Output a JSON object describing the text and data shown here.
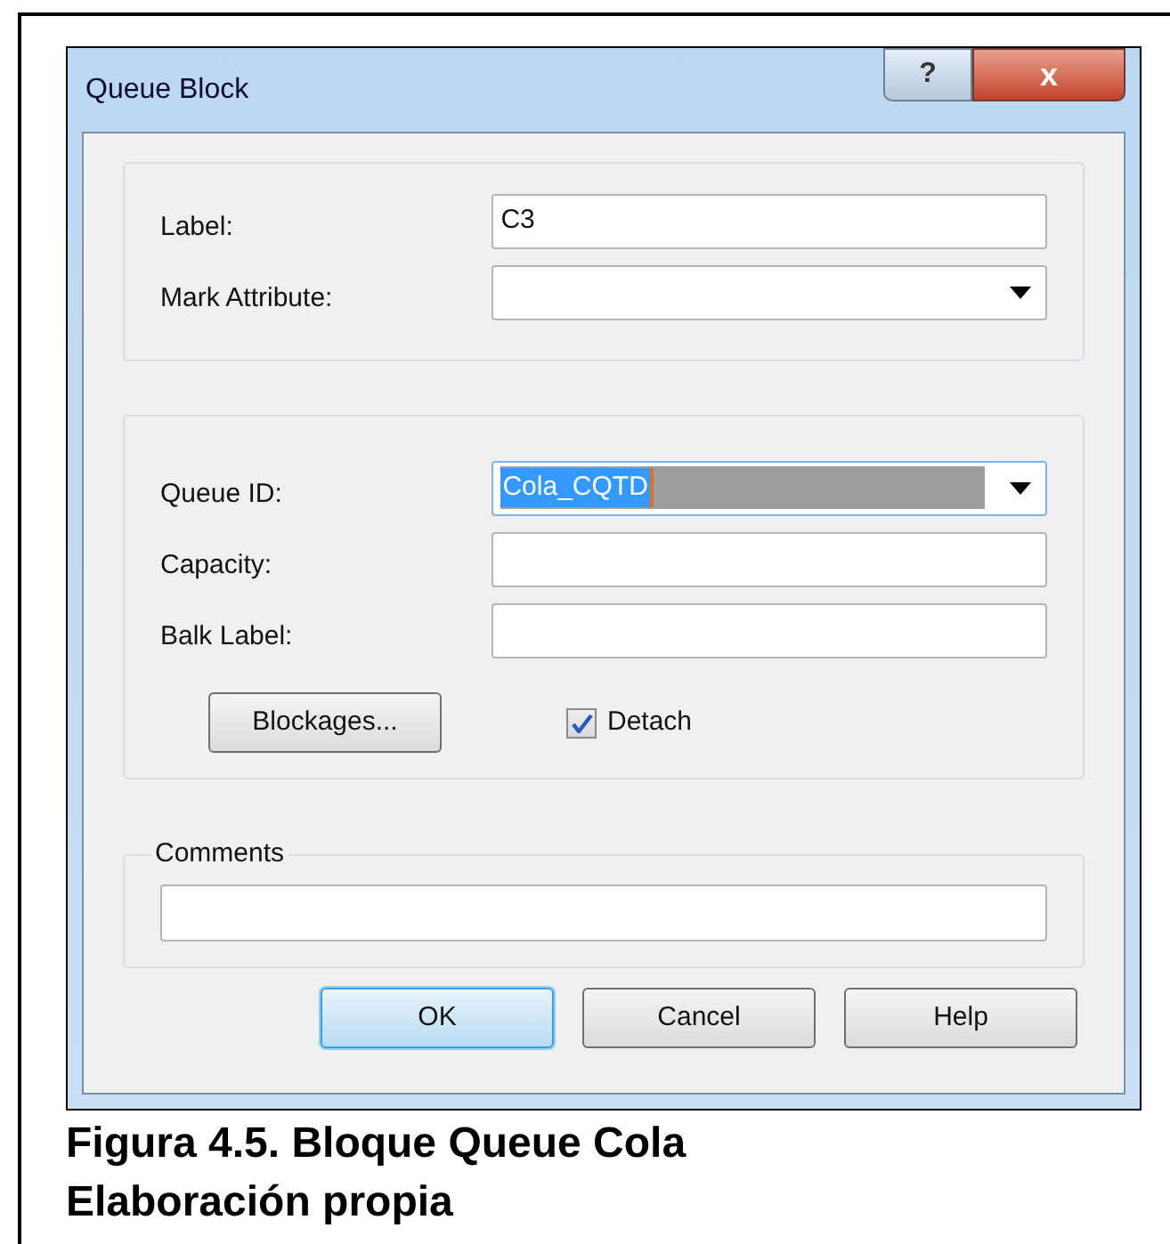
{
  "window": {
    "title": "Queue Block",
    "buttons": [
      "?",
      "x"
    ]
  },
  "general": {
    "fields": [
      {
        "label": "Label:",
        "value": "C3",
        "kind": "text"
      },
      {
        "label": "Mark Attribute:",
        "kind": "dropdown"
      }
    ]
  },
  "queue": {
    "fields": [
      {
        "label": "Queue ID:",
        "value": "Cola_CQTD",
        "kind": "dropdown",
        "selected": true
      },
      {
        "label": "Capacity:",
        "kind": "text"
      },
      {
        "label": "Balk Label:",
        "kind": "text"
      }
    ],
    "blockages_button": "Blockages...",
    "detach": {
      "label": "Detach",
      "checked": true
    }
  },
  "comments": {
    "legend": "Comments"
  },
  "buttons": [
    {
      "label": "OK",
      "selected": true
    },
    {
      "label": "Cancel",
      "selected": false
    },
    {
      "label": "Help",
      "selected": false
    }
  ],
  "caption": [
    "Figura 4.5. Bloque Queue Cola",
    "Elaboración propia"
  ]
}
